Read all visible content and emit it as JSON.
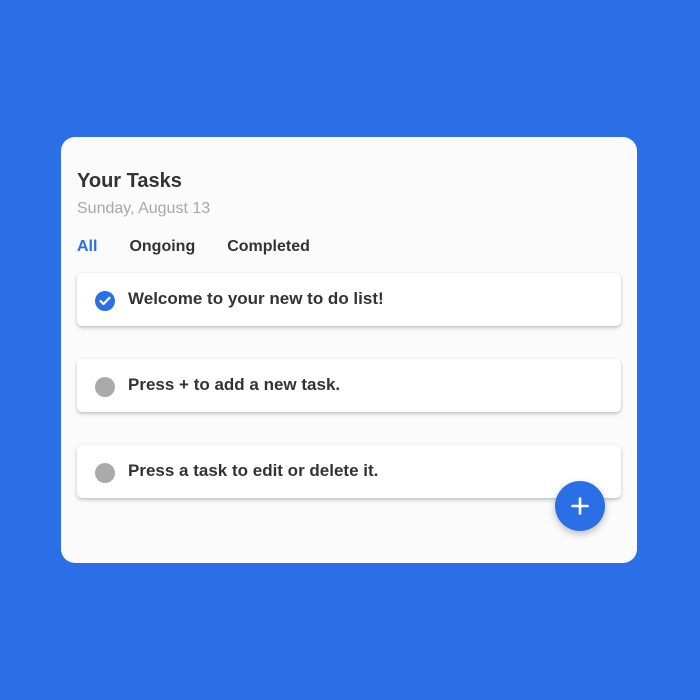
{
  "header": {
    "title": "Your Tasks",
    "date": "Sunday, August 13"
  },
  "tabs": [
    {
      "label": "All",
      "active": true
    },
    {
      "label": "Ongoing",
      "active": false
    },
    {
      "label": "Completed",
      "active": false
    }
  ],
  "tasks": [
    {
      "label": "Welcome to your new to do list!",
      "completed": true
    },
    {
      "label": "Press + to add a new task.",
      "completed": false
    },
    {
      "label": "Press a task to edit or delete it.",
      "completed": false
    }
  ],
  "fab": {
    "icon": "plus-icon"
  },
  "colors": {
    "background": "#2b6fe6",
    "accent": "#2b6fe6",
    "card": "#fbfbfb",
    "pending_circle": "#aaaaaa",
    "text": "#333333",
    "muted_text": "#a8a8a8"
  }
}
